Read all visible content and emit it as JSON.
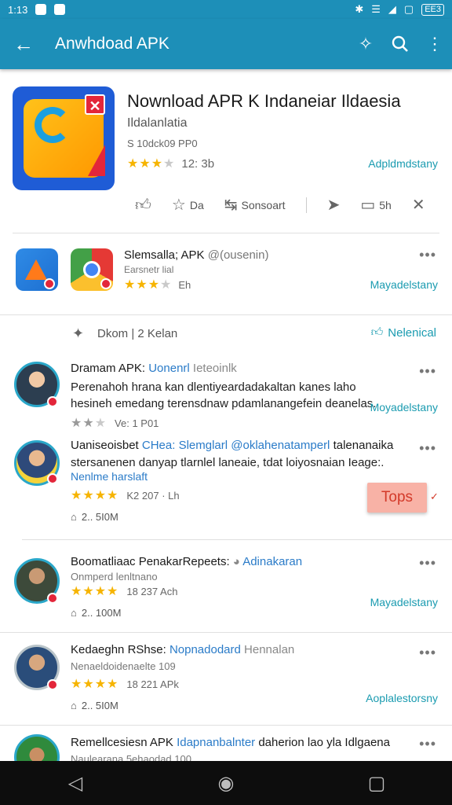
{
  "status_bar": {
    "time": "1:13",
    "battery": "EE3"
  },
  "app_bar": {
    "title": "Anwhdoad APK",
    "icons": [
      "back-arrow-icon",
      "settings-cog-icon",
      "search-icon",
      "more-vert-icon"
    ]
  },
  "app": {
    "title": "Nownload APR K Indaneiar Ildaesia",
    "subtitle": "Ildalanlatia",
    "meta": "S 10dck09 PP0",
    "rating_text": "12: 3b",
    "stars": 3.5,
    "link": "Adpldmdstany",
    "actions": [
      {
        "icon": "thumbs-up-icon",
        "label": ""
      },
      {
        "icon": "star-icon",
        "label": "Da"
      },
      {
        "icon": "share-icon",
        "label": "Sonsoart"
      },
      {
        "icon": "forward-icon",
        "label": ""
      },
      {
        "icon": "comment-icon",
        "label": "5h"
      },
      {
        "icon": "close-icon",
        "label": ""
      }
    ]
  },
  "related": {
    "title": "Slemsalla; APK",
    "title_suffix": "@(ousenin)",
    "sub": "Earsnetr lial",
    "rating_text": "Eh",
    "stars": 3,
    "link": "Mayadelstany"
  },
  "filter": {
    "label": "Dkom | 2 Kelan",
    "right": "Nelenical"
  },
  "reviews": [
    {
      "name": "Dramam APK:",
      "tag": "Uonenrl",
      "tag2": "Ieteoinlk",
      "text": "Perenahoh hrana kan dlentiyeardadakaltan kanes laho hesineh emedang terensdnaw pdamlanangefein deanelas.",
      "rating_text": "Ve: 1 P01",
      "stars": 2,
      "right": "Moyadelstany"
    },
    {
      "name": "Uaniseoisbet",
      "tag": "CHea: Slemglarl @oklahenatamperl",
      "tag2": "talenanaika",
      "text": "stersanenen danyap tlarnlel laneaie, tdat loiyosnaian Ieage:.",
      "link": "Nenlme harslaft",
      "rating_text": "K2  207 · Lh",
      "stars": 4,
      "size": "2.. 5I0M",
      "badge": "Tops"
    },
    {
      "name": "Boomatliaac PenakarRepeets:",
      "tag": "Adinakaran",
      "sub": "Onmperd lenltnano",
      "rating_text": "18  237  Ach",
      "stars": 4,
      "size": "2.. 100M",
      "right": "Mayadelstany"
    },
    {
      "name": "Kedaeghn RShse:",
      "tag": "Nopnadodard",
      "tag2": "Hennalan",
      "sub": "Nenaeldoidenaelte 109",
      "rating_text": "18  221  APk",
      "stars": 4,
      "size": "2.. 5I0M",
      "right": "Aoplalestorsny"
    },
    {
      "name": "Remellcesiesn APK",
      "tag": "Idapnanbalnter",
      "tag2": "daherion lao yla Idlgaena",
      "sub": "Naulearana 5ehaodad 100"
    }
  ],
  "nav_bar": {
    "icons": [
      "nav-back-icon",
      "nav-home-icon",
      "nav-recents-icon"
    ]
  },
  "colors": {
    "primary": "#1d8fb8",
    "accent": "#1a9bb0",
    "star": "#f6b400",
    "badge": "#e3263a"
  }
}
